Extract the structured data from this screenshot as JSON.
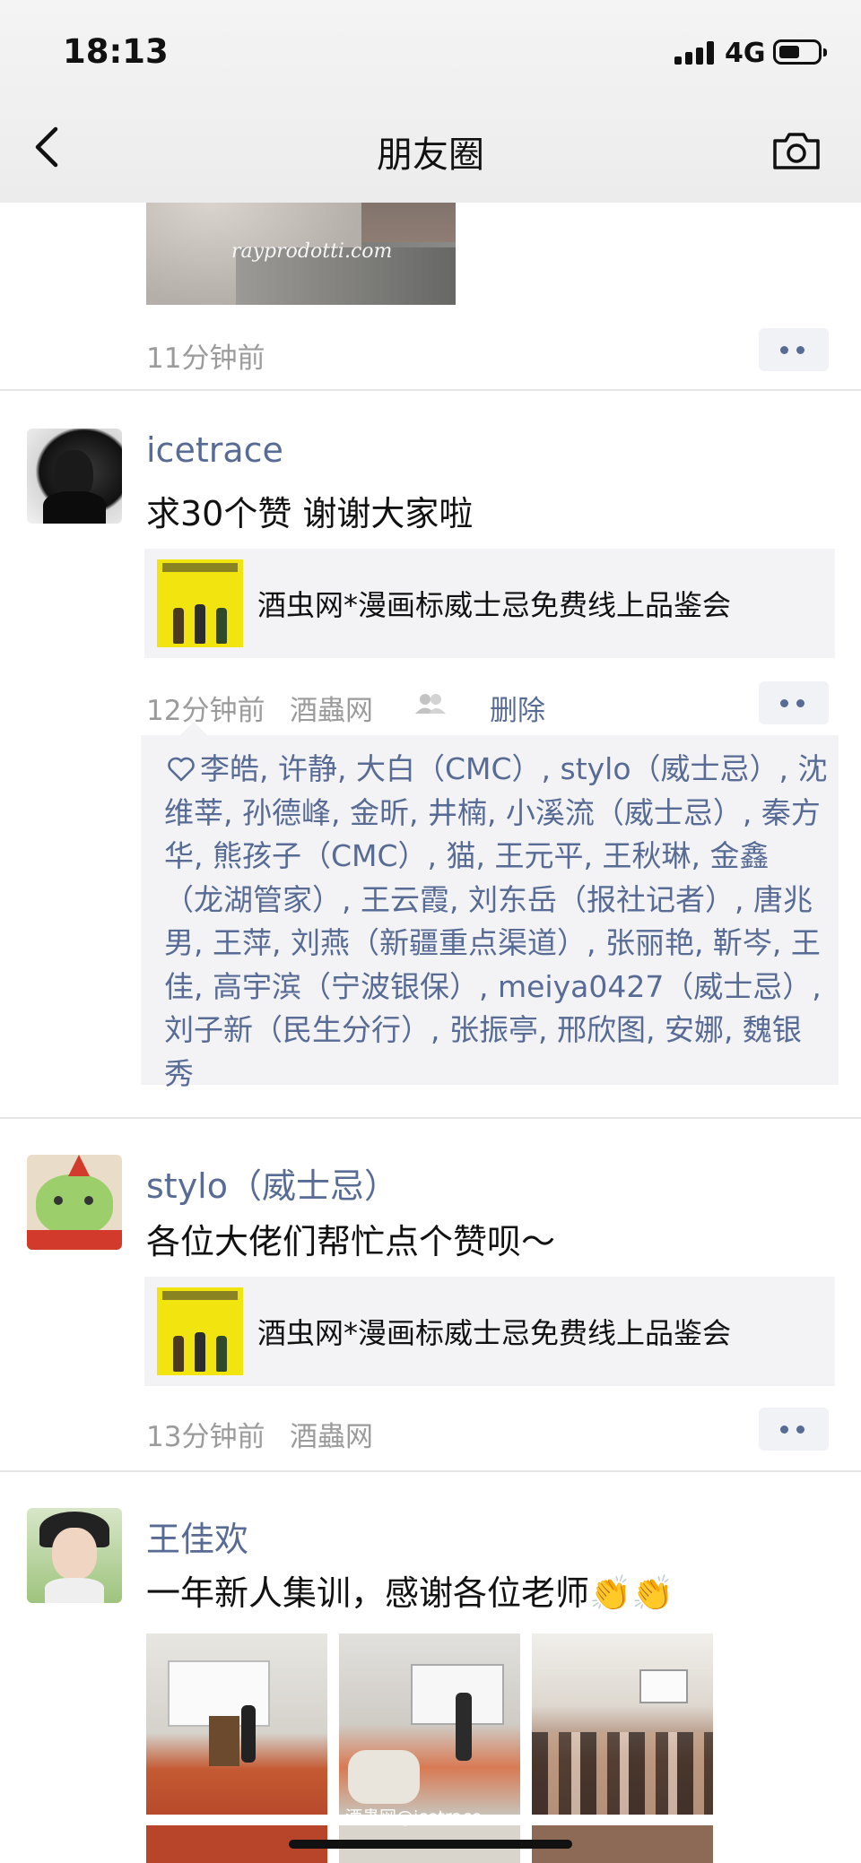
{
  "status_bar": {
    "time": "18:13",
    "network": "4G"
  },
  "nav": {
    "title": "朋友圈"
  },
  "posts": [
    {
      "image_caption": "rayprodotti.com",
      "time": "11分钟前"
    },
    {
      "author": "icetrace",
      "text": "求30个赞 谢谢大家啦",
      "link_title": "酒虫网*漫画标威士忌免费线上品鉴会",
      "time": "12分钟前",
      "source": "酒蟲网",
      "delete_label": "删除",
      "likes": "李皓, 许静, 大白（CMC）, stylo（威士忌）, 沈维莘, 孙德峰, 金昕, 井楠, 小溪流（威士忌）, 秦方华, 熊孩子（CMC）, 猫, 王元平, 王秋琳, 金鑫（龙湖管家）, 王云霞, 刘东岳（报社记者）, 唐兆男, 王萍, 刘燕（新疆重点渠道）, 张丽艳, 靳岑, 王佳, 高宇滨（宁波银保）, meiya0427（威士忌）, 刘子新（民生分行）, 张振亭, 邢欣图, 安娜, 魏银秀"
    },
    {
      "author": "stylo（威士忌）",
      "text": "各位大佬们帮忙点个赞呗～",
      "link_title": "酒虫网*漫画标威士忌免费线上品鉴会",
      "time": "13分钟前",
      "source": "酒蟲网"
    },
    {
      "author": "王佳欢",
      "text": "一年新人集训，感谢各位老师👏👏"
    }
  ],
  "watermark": "酒蟲网@icetrace",
  "colors": {
    "link_blue": "#576b95",
    "meta_gray": "#9b9b9b",
    "card_bg": "#f3f3f5"
  }
}
